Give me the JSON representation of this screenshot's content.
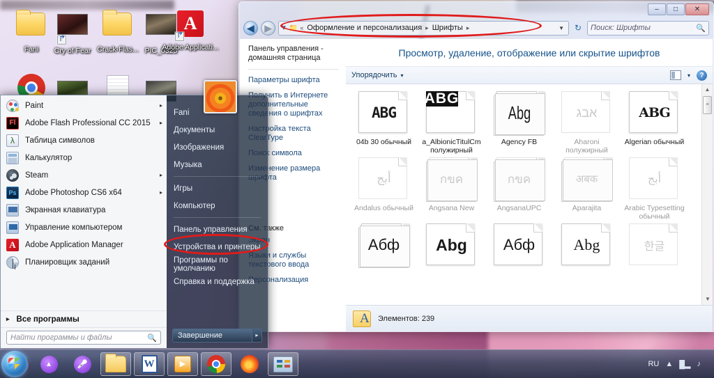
{
  "desktop": {
    "icons": [
      {
        "label": "Fani",
        "icon": "user-folder-icon"
      },
      {
        "label": "Cry of Fear",
        "icon": "game-shortcut-icon"
      },
      {
        "label": "Crack-Flas...",
        "icon": "folder-icon"
      },
      {
        "label": "PIC_0325",
        "icon": "photo-icon"
      },
      {
        "label": "Adobe Applicati...",
        "icon": "adobe-shortcut-icon"
      },
      {
        "label": "",
        "icon": "chrome-icon"
      },
      {
        "label": "",
        "icon": "photo-icon"
      },
      {
        "label": "",
        "icon": "document-icon"
      },
      {
        "label": "",
        "icon": "photo-icon"
      }
    ]
  },
  "explorer": {
    "window_buttons": {
      "minimize": "–",
      "maximize": "□",
      "close": "✕"
    },
    "nav": {
      "back": "◀",
      "forward": "▶",
      "dropdown": "▼",
      "refresh": "↻"
    },
    "address": {
      "icon": "fonts-folder-icon",
      "chevron": "«",
      "crumbs": [
        "Оформление и персонализация",
        "Шрифты"
      ],
      "separator": "▸"
    },
    "search": {
      "placeholder": "Поиск: Шрифты",
      "icon": "🔍"
    },
    "left_pane": {
      "home": "Панель управления - домашняя страница",
      "links": [
        "Параметры шрифта",
        "Получить в Интернете дополнительные сведения о шрифтах",
        "Настройка текста ClearType",
        "Поиск символа",
        "Изменение размера шрифта"
      ],
      "see_also_title": "См. также",
      "see_also": [
        "Экран",
        "Языки и службы текстового ввода",
        "Персонализация"
      ]
    },
    "page_title": "Просмотр, удаление, отображение или скрытие шрифтов",
    "toolbar": {
      "organize": "Упорядочить",
      "organize_caret": "▾",
      "view_caret": "▾",
      "help": "?"
    },
    "fonts": [
      {
        "name": "04b 30 обычный",
        "sample": "ABG",
        "style": "pixel",
        "hidden": false,
        "multi": false
      },
      {
        "name": "a_AlbionicTitulCm полужирный",
        "sample": "ABG",
        "style": "invert",
        "hidden": false,
        "multi": false
      },
      {
        "name": "Agency FB",
        "sample": "Abg",
        "style": "condensed",
        "hidden": false,
        "multi": true
      },
      {
        "name": "Aharoni полужирный",
        "sample": "אבג",
        "style": "plain",
        "hidden": true,
        "multi": false
      },
      {
        "name": "Algerian обычный",
        "sample": "ABG",
        "style": "serif",
        "hidden": false,
        "multi": false
      },
      {
        "name": "Andalus обычный",
        "sample": "أبج",
        "style": "plain",
        "hidden": true,
        "multi": false
      },
      {
        "name": "Angsana New",
        "sample": "กขค",
        "style": "plain",
        "hidden": true,
        "multi": true
      },
      {
        "name": "AngsanaUPC",
        "sample": "กขค",
        "style": "plain",
        "hidden": true,
        "multi": true
      },
      {
        "name": "Aparajita",
        "sample": "अबक",
        "style": "plain",
        "hidden": true,
        "multi": true
      },
      {
        "name": "Arabic Typesetting обычный",
        "sample": "أبج",
        "style": "plain",
        "hidden": true,
        "multi": false
      },
      {
        "name": "",
        "sample": "Абф",
        "style": "plain",
        "hidden": false,
        "multi": true
      },
      {
        "name": "",
        "sample": "Abg",
        "style": "bold",
        "hidden": false,
        "multi": false
      },
      {
        "name": "",
        "sample": "Абф",
        "style": "plain",
        "hidden": false,
        "multi": false
      },
      {
        "name": "",
        "sample": "Abg",
        "style": "serif",
        "hidden": false,
        "multi": false
      },
      {
        "name": "",
        "sample": "한글",
        "style": "plain",
        "hidden": true,
        "multi": false
      }
    ],
    "scrollbar": {
      "up": "▲",
      "thumb": "≡",
      "down": "▼"
    },
    "status": {
      "icon": "fonts-folder-icon",
      "text": "Элементов: 239"
    }
  },
  "start_menu": {
    "programs": [
      {
        "label": "Paint",
        "icon": "paint-icon",
        "arrow": "▸"
      },
      {
        "label": "Adobe Flash Professional CC 2015",
        "icon": "flash-icon",
        "arrow": "▸"
      },
      {
        "label": "Таблица символов",
        "icon": "charmap-icon",
        "arrow": ""
      },
      {
        "label": "Калькулятор",
        "icon": "calculator-icon",
        "arrow": ""
      },
      {
        "label": "Steam",
        "icon": "steam-icon",
        "arrow": "▸"
      },
      {
        "label": "Adobe Photoshop CS6 x64",
        "icon": "photoshop-icon",
        "arrow": "▸"
      },
      {
        "label": "Экранная клавиатура",
        "icon": "onscreen-keyboard-icon",
        "arrow": ""
      },
      {
        "label": "Управление компьютером",
        "icon": "computer-management-icon",
        "arrow": ""
      },
      {
        "label": "Adobe Application Manager",
        "icon": "adobe-icon",
        "arrow": ""
      },
      {
        "label": "Планировщик заданий",
        "icon": "task-scheduler-icon",
        "arrow": ""
      }
    ],
    "all_programs": {
      "label": "Все программы",
      "arrow": "▸"
    },
    "search": {
      "placeholder": "Найти программы и файлы",
      "icon": "🔍"
    },
    "right_items": [
      "Fani",
      "Документы",
      "Изображения",
      "Музыка",
      "Игры",
      "Компьютер",
      "Панель управления",
      "Устройства и принтеры",
      "Программы по умолчанию",
      "Справка и поддержка"
    ],
    "shutdown": {
      "label": "Завершение работы",
      "arrow": "▸"
    },
    "avatar": "user-avatar-flower"
  },
  "annotations": {
    "color": "#e01b1b",
    "items": [
      "address-bar-highlight",
      "control-panel-item-highlight",
      "start-orb-highlight"
    ]
  },
  "taskbar": {
    "start": "start-orb-icon",
    "buttons": [
      {
        "icon": "yandex-icon",
        "active": false
      },
      {
        "icon": "voice-assistant-icon",
        "active": false
      },
      {
        "icon": "explorer-icon",
        "active": true
      },
      {
        "icon": "word-icon",
        "active": true
      },
      {
        "icon": "media-player-icon",
        "active": true
      },
      {
        "icon": "chrome-icon",
        "active": true
      },
      {
        "icon": "firefox-icon",
        "active": false
      },
      {
        "icon": "control-panel-icon",
        "active": true
      }
    ],
    "tray": {
      "language": "RU",
      "show_hidden": "▲",
      "network": "█▂",
      "volume": "♪",
      "clock": ""
    }
  }
}
